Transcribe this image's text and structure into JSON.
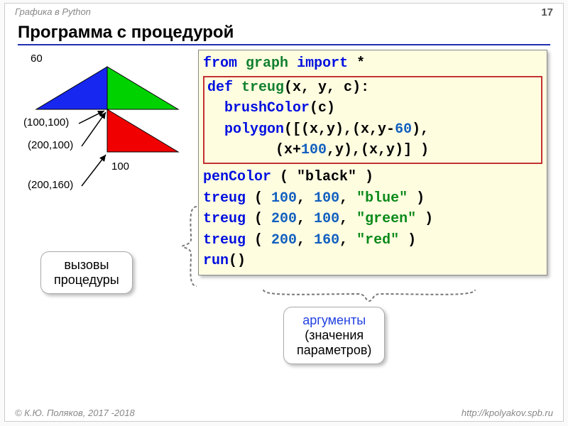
{
  "header": {
    "course": "Графика в Python",
    "page": "17"
  },
  "title": "Программа с процедурой",
  "diagram": {
    "side_label": "60",
    "base_label": "100",
    "coord1": "(100,100)",
    "coord2": "(200,100)",
    "coord3": "(200,160)"
  },
  "code": {
    "l1_from": "from",
    "l1_mod": "graph",
    "l1_imp": "import",
    "l1_star": "*",
    "l2_def": "def",
    "l2_name": "treug",
    "l2_args": "(x, y, c):",
    "l3_call": "brushColor",
    "l3_arg": "(c)",
    "l4_call": "polygon",
    "l4_a": "([(x,y),(x,y-",
    "l4_n1": "60",
    "l4_b": "),",
    "l5_pad": "        ",
    "l5_a": "(x+",
    "l5_n1": "100",
    "l5_b": ",y),(x,y)] )",
    "l6_call": "penColor",
    "l6_arg": " ( \"black\" )",
    "l7_call": "treug",
    "l7_a": " ( ",
    "l7_n1": "100",
    "l7_c1": ", ",
    "l7_n2": "100",
    "l7_c2": ", ",
    "l7_s": "\"blue\"",
    "l7_e": " )",
    "l8_call": "treug",
    "l8_a": " ( ",
    "l8_n1": "200",
    "l8_c1": ", ",
    "l8_n2": "100",
    "l8_c2": ", ",
    "l8_s": "\"green\"",
    "l8_e": " )",
    "l9_call": "treug",
    "l9_a": " ( ",
    "l9_n1": "200",
    "l9_c1": ", ",
    "l9_n2": "160",
    "l9_c2": ", ",
    "l9_s": "\"red\"",
    "l9_e": " )",
    "l10_call": "run",
    "l10_e": "()"
  },
  "callouts": {
    "calls_l1": "вызовы",
    "calls_l2": "процедуры",
    "args_l1": "аргументы",
    "args_l2": "(значения",
    "args_l3": "параметров)"
  },
  "footer": {
    "left": "© К.Ю. Поляков, 2017 -2018",
    "right": "http://kpolyakov.spb.ru"
  }
}
